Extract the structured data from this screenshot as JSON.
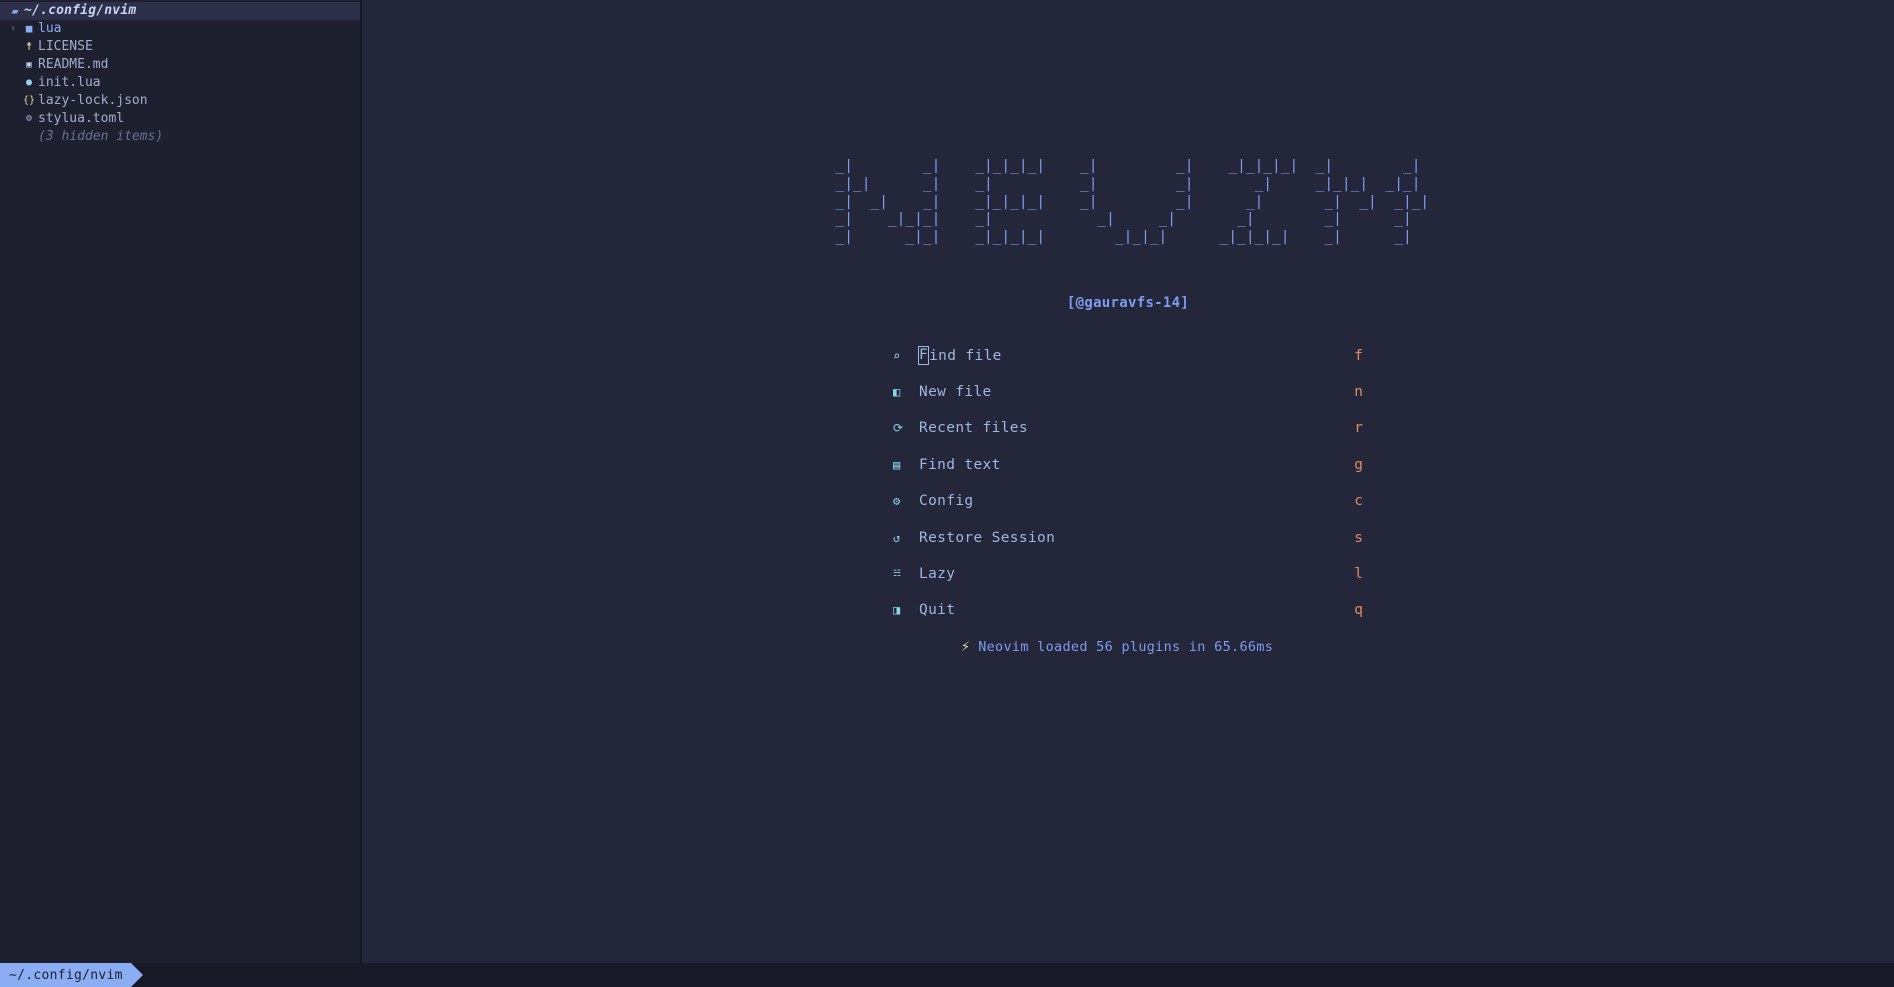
{
  "sidebar": {
    "title": {
      "icon": "folder-open-icon",
      "glyph": "▰",
      "label": "~/.config/nvim"
    },
    "items": [
      {
        "name": "lua",
        "type": "dir",
        "icon": "folder-icon",
        "glyph": "■",
        "color": "#8aadf4",
        "arrow": "›"
      },
      {
        "name": "LICENSE",
        "type": "file",
        "icon": "key-icon",
        "glyph": "☨",
        "color": "#eed49f",
        "arrow": ""
      },
      {
        "name": "README.md",
        "type": "file",
        "icon": "markdown-icon",
        "glyph": "▣",
        "color": "#cad3f5",
        "arrow": ""
      },
      {
        "name": "init.lua",
        "type": "file",
        "icon": "lua-icon",
        "glyph": "●",
        "color": "#8bd5e8",
        "arrow": ""
      },
      {
        "name": "lazy-lock.json",
        "type": "file",
        "icon": "json-icon",
        "glyph": "{}",
        "color": "#eed49f",
        "arrow": ""
      },
      {
        "name": "stylua.toml",
        "type": "file",
        "icon": "gear-icon",
        "glyph": "⚙",
        "color": "#a5adcb",
        "arrow": ""
      }
    ],
    "hidden_note": "(3 hidden items)"
  },
  "dashboard": {
    "ascii_art": " _|        _|    _|_|_|_|    _|         _|    _|_|_|_|  _|        _|\n _|_|      _|    _|          _|         _|       _|     _|_|_|  _|_|\n _|  _|    _|    _|_|_|_|    _|         _|      _|       _|  _|  _|_|\n _|    _|_|_|    _|            _|     _|       _|        _|      _|\n _|      _|_|    _|_|_|_|        _|_|_|      _|_|_|_|    _|      _|",
    "banner_user": "[@gauravfs-14]",
    "menu": [
      {
        "icon": "search-icon",
        "glyph": "⌕",
        "label": "Find file",
        "key": "f"
      },
      {
        "icon": "file-icon",
        "glyph": "◧",
        "label": "New file",
        "key": "n"
      },
      {
        "icon": "history-icon",
        "glyph": "⟳",
        "label": "Recent files",
        "key": "r"
      },
      {
        "icon": "text-icon",
        "glyph": "▤",
        "label": "Find text",
        "key": "g"
      },
      {
        "icon": "gear-icon",
        "glyph": "⚙",
        "label": "Config",
        "key": "c"
      },
      {
        "icon": "restore-icon",
        "glyph": "↺",
        "label": "Restore Session",
        "key": "s"
      },
      {
        "icon": "lazy-icon",
        "glyph": "☵",
        "label": "Lazy",
        "key": "l"
      },
      {
        "icon": "exit-icon",
        "glyph": "◨",
        "label": "Quit",
        "key": "q"
      }
    ],
    "cursor_on": "F",
    "footer": {
      "bolt": "⚡",
      "text": "Neovim loaded 56 plugins in 65.66ms"
    }
  },
  "statusline": {
    "path": "~/.config/nvim"
  },
  "colors": {
    "editor_bg": "#24273a",
    "sidebar_bg": "#1e2030",
    "accent_blue": "#8aadf4",
    "text": "#cad3f5",
    "muted": "#a5adcb",
    "key": "#e08a64",
    "cyan": "#8bd5e8",
    "yellow": "#eed49f"
  }
}
